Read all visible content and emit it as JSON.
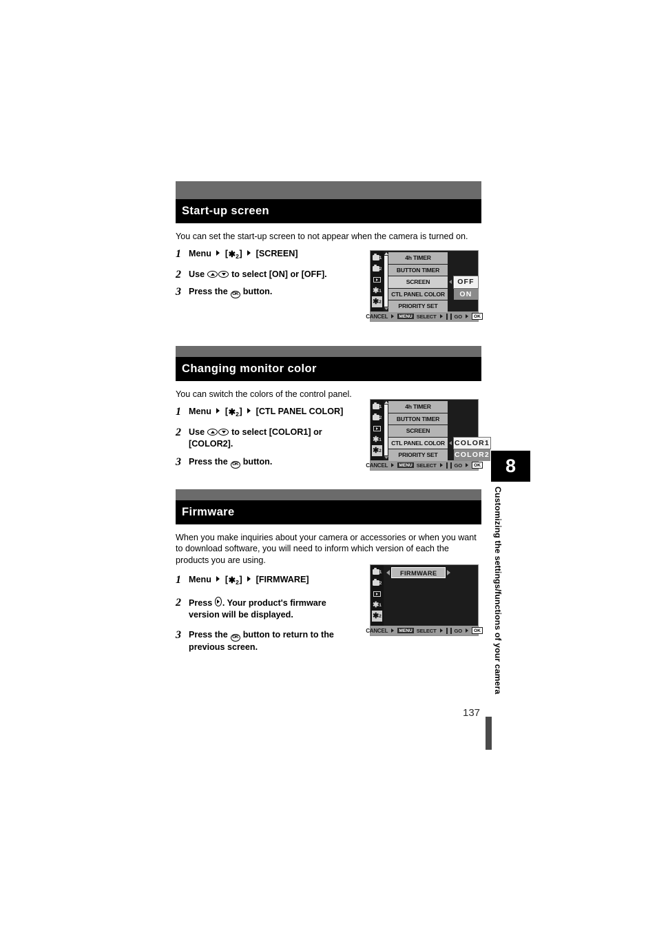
{
  "page": {
    "number": "137",
    "chapter_number": "8",
    "chapter_title": "Customizing the settings/functions of your camera"
  },
  "sections": [
    {
      "id": "startup-screen",
      "heading": "Start-up screen",
      "intro": "You can set the start-up screen to not appear when the camera is turned on.",
      "steps": [
        {
          "num": "1",
          "parts": [
            "Menu",
            "arrow",
            "[",
            "wrench2",
            "]",
            "arrow",
            "[SCREEN]"
          ],
          "text": "Menu  ▸ [ ↑2 ] ▸ [SCREEN]"
        },
        {
          "num": "2",
          "text": "Use  to select [ON] or [OFF]."
        },
        {
          "num": "3",
          "text": "Press the  button."
        }
      ],
      "step_text": {
        "s1_menu": "Menu",
        "s1_bracket_open": "[",
        "s1_bracket_close": "]",
        "s1_tab_sub": "2",
        "s1_target": "[SCREEN]",
        "s2_pre": "Use",
        "s2_post": "to select [ON] or [OFF].",
        "s3_pre": "Press the",
        "s3_post": "button."
      }
    },
    {
      "id": "changing-monitor-color",
      "heading": "Changing monitor color",
      "intro": "You can switch the colors of the control panel.",
      "step_text": {
        "s1_menu": "Menu",
        "s1_bracket_open": "[",
        "s1_bracket_close": "]",
        "s1_tab_sub": "2",
        "s1_target": "[CTL PANEL COLOR]",
        "s2_pre": "Use",
        "s2_post": "to select [COLOR1] or",
        "s2_line2": "[COLOR2].",
        "s3_pre": "Press the",
        "s3_post": "button."
      }
    },
    {
      "id": "firmware",
      "heading": "Firmware",
      "intro": "When you make inquiries about your camera or accessories or when you want to download software, you will need to inform which version of each the products you are using.",
      "step_text": {
        "s1_menu": "Menu",
        "s1_bracket_open": "[",
        "s1_bracket_close": "]",
        "s1_tab_sub": "2",
        "s1_target": "[FIRMWARE]",
        "s2_pre": "Press",
        "s2_post": ". Your product's firmware",
        "s2_line2": "version will be displayed.",
        "s3_pre": "Press the",
        "s3_post": "button to return to the",
        "s3_line2": "previous screen."
      }
    }
  ],
  "lcd_screens": [
    {
      "id": "lcd-screen-setup2",
      "tabs": [
        {
          "name": "camera1",
          "sub": "1",
          "active": false
        },
        {
          "name": "camera2",
          "sub": "2",
          "active": false
        },
        {
          "name": "playback",
          "sub": "",
          "active": false
        },
        {
          "name": "wrench1",
          "sub": "1",
          "active": false
        },
        {
          "name": "wrench2",
          "sub": "2",
          "active": true
        }
      ],
      "rows": [
        {
          "label": "4h TIMER",
          "value": "",
          "selected": false,
          "caret": false,
          "highlight": false
        },
        {
          "label": "BUTTON TIMER",
          "value": "",
          "selected": false,
          "caret": false,
          "highlight": false
        },
        {
          "label": "SCREEN",
          "value": "OFF",
          "selected": true,
          "caret": true,
          "highlight": true
        },
        {
          "label": "CTL PANEL COLOR",
          "value": "ON",
          "selected": false,
          "caret": false,
          "highlight": false
        },
        {
          "label": "PRIORITY SET",
          "value": "",
          "selected": false,
          "caret": false,
          "highlight": false
        }
      ],
      "bar": {
        "cancel": "CANCEL",
        "cancel_chip": "MENU",
        "select": "SELECT",
        "go": "GO",
        "go_chip": "OK"
      }
    },
    {
      "id": "lcd-screen-ctl-panel-color",
      "tabs": [
        {
          "name": "camera1",
          "sub": "1",
          "active": false
        },
        {
          "name": "camera2",
          "sub": "2",
          "active": false
        },
        {
          "name": "playback",
          "sub": "",
          "active": false
        },
        {
          "name": "wrench1",
          "sub": "1",
          "active": false
        },
        {
          "name": "wrench2",
          "sub": "2",
          "active": true
        }
      ],
      "rows": [
        {
          "label": "4h TIMER",
          "value": "",
          "selected": false,
          "caret": false,
          "highlight": false
        },
        {
          "label": "BUTTON TIMER",
          "value": "",
          "selected": false,
          "caret": false,
          "highlight": false
        },
        {
          "label": "SCREEN",
          "value": "",
          "selected": false,
          "caret": false,
          "highlight": false
        },
        {
          "label": "CTL PANEL COLOR",
          "value": "COLOR1",
          "selected": true,
          "caret": true,
          "highlight": true
        },
        {
          "label": "PRIORITY SET",
          "value": "COLOR2",
          "selected": false,
          "caret": false,
          "highlight": false
        }
      ],
      "bar": {
        "cancel": "CANCEL",
        "cancel_chip": "MENU",
        "select": "SELECT",
        "go": "GO",
        "go_chip": "OK"
      }
    },
    {
      "id": "lcd-screen-firmware",
      "tabs": [
        {
          "name": "camera1",
          "sub": "1",
          "active": false
        },
        {
          "name": "camera2",
          "sub": "2",
          "active": false
        },
        {
          "name": "playback",
          "sub": "",
          "active": false
        },
        {
          "name": "wrench1",
          "sub": "1",
          "active": false
        },
        {
          "name": "wrench2",
          "sub": "2",
          "active": true
        }
      ],
      "pill": "FIRMWARE",
      "bar": {
        "cancel": "CANCEL",
        "cancel_chip": "MENU",
        "select": "SELECT",
        "go": "GO",
        "go_chip": "OK"
      }
    }
  ]
}
